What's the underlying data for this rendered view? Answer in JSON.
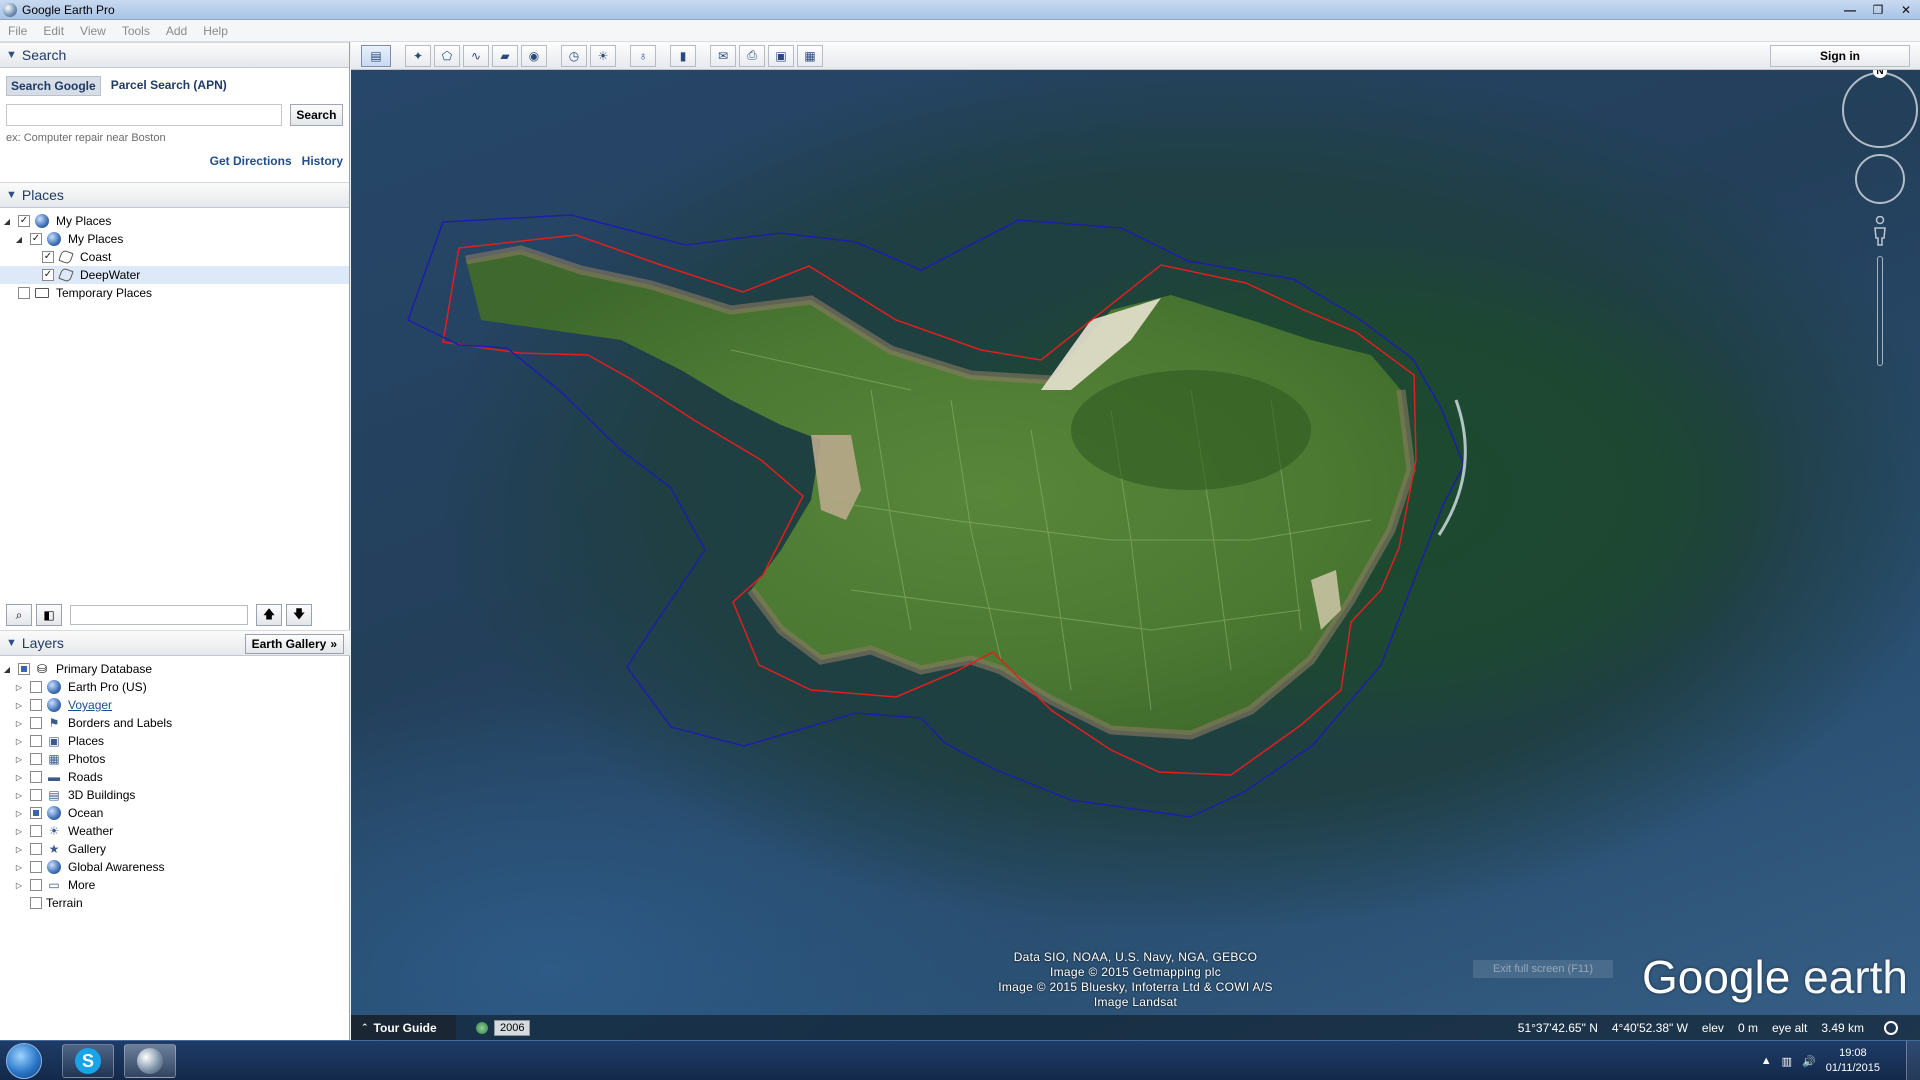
{
  "window": {
    "title": "Google Earth Pro",
    "controls": [
      "—",
      "❐",
      "✕"
    ]
  },
  "menu": [
    "File",
    "Edit",
    "View",
    "Tools",
    "Add",
    "Help"
  ],
  "search": {
    "header": "Search",
    "tabs": [
      "Search Google",
      "Parcel Search (APN)"
    ],
    "input_value": "",
    "button": "Search",
    "hint": "ex: Computer repair near Boston",
    "links": [
      "Get Directions",
      "History"
    ]
  },
  "places": {
    "header": "Places",
    "items": [
      {
        "label": "My Places",
        "level": 0,
        "checked": "✓",
        "expander": "◢"
      },
      {
        "label": "My Places",
        "level": 1,
        "checked": "✓",
        "expander": "◢"
      },
      {
        "label": "Coast",
        "level": 2,
        "checked": "✓"
      },
      {
        "label": "DeepWater",
        "level": 2,
        "checked": "✓",
        "selected": true
      },
      {
        "label": "Temporary Places",
        "level": 0,
        "checked": ""
      }
    ]
  },
  "panel_tools": {
    "up": "🡅",
    "down": "🡇"
  },
  "layers": {
    "header": "Layers",
    "gallery_button": "Earth Gallery",
    "gallery_arrow": "»",
    "root": "Primary Database",
    "items": [
      {
        "label": "Earth Pro (US)",
        "icon": "globe-icon"
      },
      {
        "label": "Voyager",
        "icon": "globe-icon",
        "link": true
      },
      {
        "label": "Borders and Labels",
        "icon": "flag-icon"
      },
      {
        "label": "Places",
        "icon": "places-icon"
      },
      {
        "label": "Photos",
        "icon": "photo-icon"
      },
      {
        "label": "Roads",
        "icon": "road-icon"
      },
      {
        "label": "3D Buildings",
        "icon": "building-icon"
      },
      {
        "label": "Ocean",
        "icon": "globe-icon",
        "checked": true
      },
      {
        "label": "Weather",
        "icon": "sun-icon"
      },
      {
        "label": "Gallery",
        "icon": "star-icon"
      },
      {
        "label": "Global Awareness",
        "icon": "globe-icon"
      },
      {
        "label": "More",
        "icon": "folder-icon"
      }
    ],
    "terrain": "Terrain"
  },
  "toolbar": {
    "sign_in": "Sign in"
  },
  "map": {
    "attribution": [
      "Data SIO, NOAA, U.S. Navy, NGA, GEBCO",
      "Image © 2015 Getmapping plc",
      "Image © 2015 Bluesky, Infoterra Ltd & COWI A/S",
      "Image Landsat"
    ],
    "logo_google": "Google",
    "logo_earth": " earth",
    "fullscreen_hint": "Exit full screen (F11)",
    "compass_n": "N",
    "colors": {
      "coast_line": "#e21e1e",
      "deepwater_line": "#1b1fa8"
    }
  },
  "status": {
    "tour_guide": "Tour Guide",
    "year": "2006",
    "lat": "51°37'42.65\" N",
    "lon": "4°40'52.38\" W",
    "elev_label": "elev",
    "elev_value": "0 m",
    "eye_label": "eye alt",
    "eye_value": "3.49 km"
  },
  "taskbar": {
    "time": "19:08",
    "date": "01/11/2015",
    "skype_letter": "S"
  }
}
